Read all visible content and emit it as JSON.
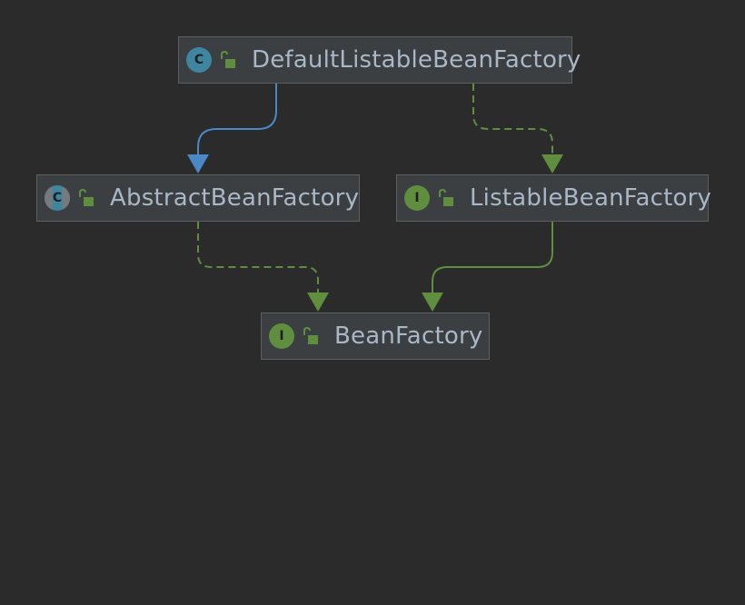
{
  "colors": {
    "background": "#2b2b2b",
    "node_fill": "#3c3f41",
    "node_border": "#5e6060",
    "node_text": "#a9b7c6",
    "extends_edge": "#4a88c7",
    "implements_edge": "#5f8e3e",
    "class_badge": "#3e86a0",
    "interface_badge": "#5f8e3e"
  },
  "nodes": [
    {
      "id": "default_listable",
      "name": "DefaultListableBeanFactory",
      "kind": "class",
      "badge": "C",
      "icon": "class-icon",
      "access_icon": "public-lock-icon"
    },
    {
      "id": "abstract",
      "name": "AbstractBeanFactory",
      "kind": "abstract-class",
      "badge": "C",
      "icon": "abstract-class-icon",
      "access_icon": "public-lock-icon"
    },
    {
      "id": "listable",
      "name": "ListableBeanFactory",
      "kind": "interface",
      "badge": "I",
      "icon": "interface-icon",
      "access_icon": "public-lock-icon"
    },
    {
      "id": "bean",
      "name": "BeanFactory",
      "kind": "interface",
      "badge": "I",
      "icon": "interface-icon",
      "access_icon": "public-lock-icon"
    }
  ],
  "edges": [
    {
      "from": "default_listable",
      "to": "abstract",
      "type": "extends",
      "style": "solid"
    },
    {
      "from": "default_listable",
      "to": "listable",
      "type": "implements",
      "style": "dashed"
    },
    {
      "from": "abstract",
      "to": "bean",
      "type": "implements",
      "style": "dashed"
    },
    {
      "from": "listable",
      "to": "bean",
      "type": "extends",
      "style": "solid"
    }
  ]
}
